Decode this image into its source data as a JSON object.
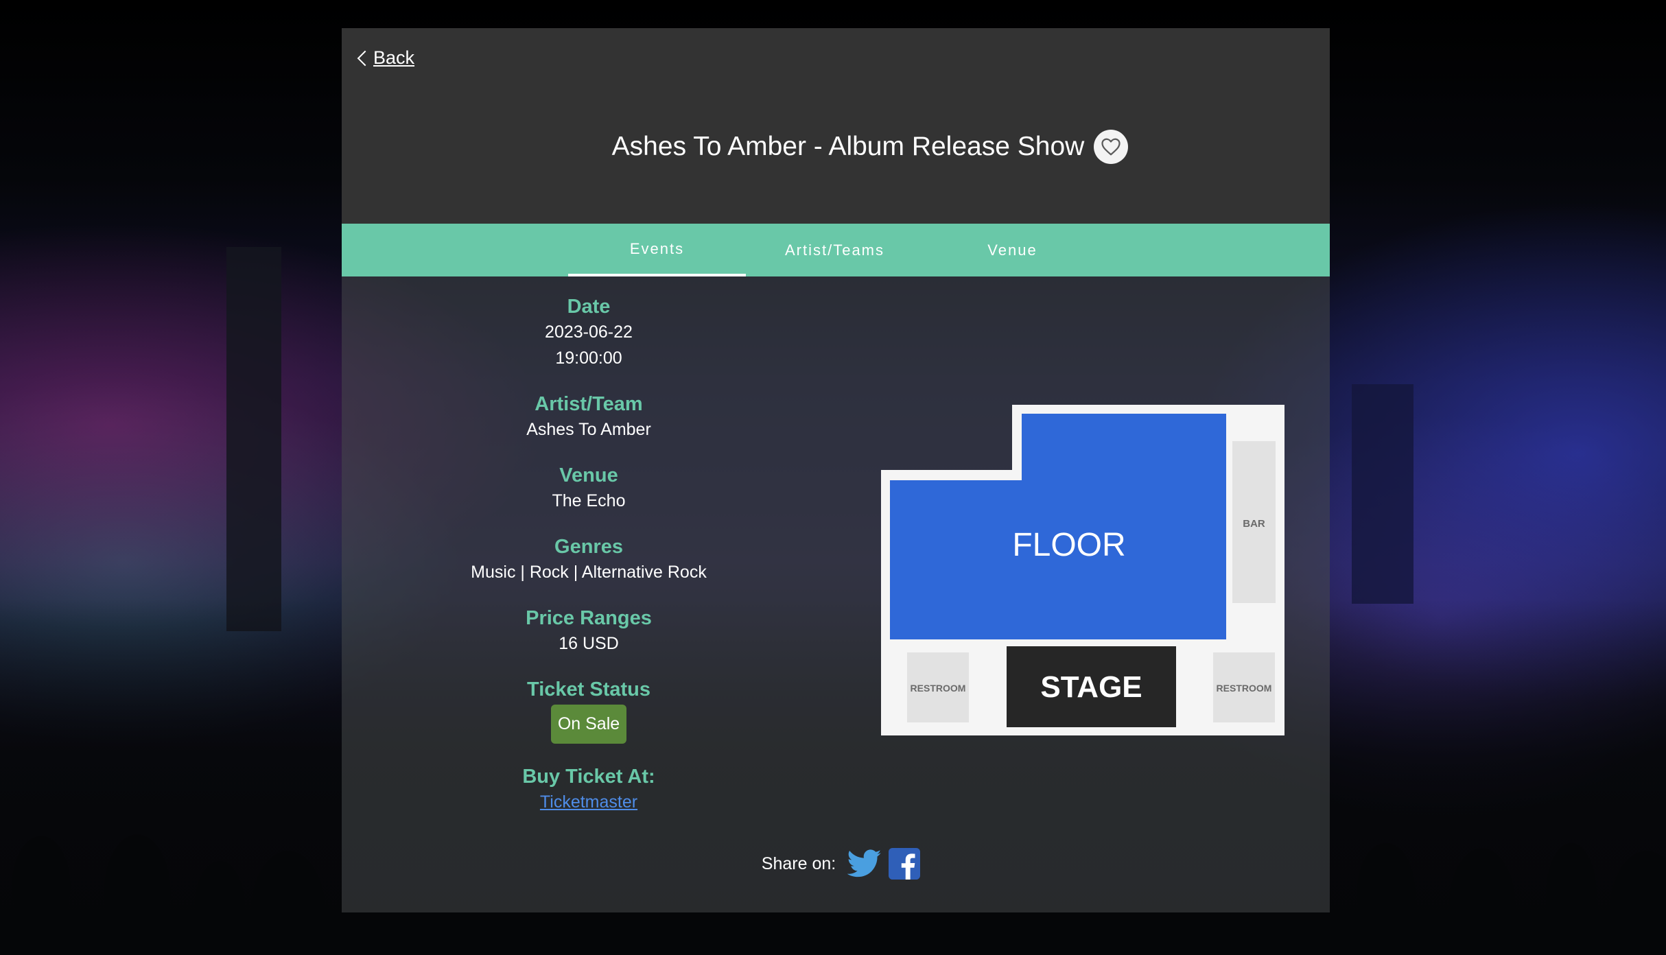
{
  "nav": {
    "back_label": "Back"
  },
  "event": {
    "title": "Ashes To Amber - Album Release Show",
    "favorite_icon": "heart-outline-icon"
  },
  "tabs": [
    {
      "label": "Events",
      "active": true
    },
    {
      "label": "Artist/Teams",
      "active": false
    },
    {
      "label": "Venue",
      "active": false
    }
  ],
  "details": {
    "date": {
      "label": "Date",
      "date": "2023-06-22",
      "time": "19:00:00"
    },
    "artist": {
      "label": "Artist/Team",
      "value": "Ashes To Amber"
    },
    "venue": {
      "label": "Venue",
      "value": "The Echo"
    },
    "genres": {
      "label": "Genres",
      "value": "Music | Rock | Alternative Rock"
    },
    "price": {
      "label": "Price Ranges",
      "value": "16 USD"
    },
    "status": {
      "label": "Ticket Status",
      "value": "On Sale"
    },
    "buy": {
      "label": "Buy Ticket At:",
      "link": "Ticketmaster"
    }
  },
  "share": {
    "label": "Share on:",
    "icons": [
      "twitter-icon",
      "facebook-icon"
    ]
  },
  "seatmap": {
    "floor": "FLOOR",
    "stage": "STAGE",
    "bar": "BAR",
    "restroom_left": "RESTROOM",
    "restroom_right": "RESTROOM"
  },
  "colors": {
    "accent": "#69c8a8",
    "header_bg": "#333333",
    "status_badge": "#5b8a3a",
    "link": "#4f8de8",
    "floor": "#2f68d8",
    "stage": "#262626",
    "twitter": "#4a9fe0",
    "facebook": "#2f5fb8"
  }
}
